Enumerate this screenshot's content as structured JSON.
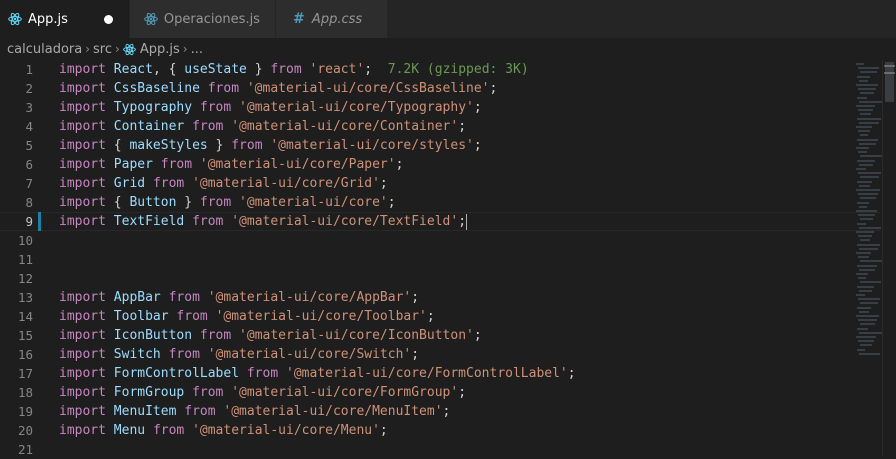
{
  "tabs": [
    {
      "label": "App.js",
      "icon": "react-icon",
      "active": true,
      "modified": true
    },
    {
      "label": "Operaciones.js",
      "icon": "react-icon",
      "active": false,
      "modified": false
    },
    {
      "label": "App.css",
      "icon": "css-hash-icon",
      "active": false,
      "modified": false
    }
  ],
  "breadcrumb": {
    "items": [
      "calculadora",
      "src",
      "App.js",
      "..."
    ]
  },
  "editor": {
    "current_line": 9,
    "lines": [
      {
        "n": "1",
        "tokens": [
          [
            "kw",
            "import"
          ],
          [
            "pn",
            " "
          ],
          [
            "id",
            "React"
          ],
          [
            "pn",
            ", { "
          ],
          [
            "id",
            "useState"
          ],
          [
            "pn",
            " } "
          ],
          [
            "kw",
            "from"
          ],
          [
            "pn",
            " "
          ],
          [
            "st",
            "'react'"
          ],
          [
            "pn",
            ";  "
          ],
          [
            "hint",
            "7.2K (gzipped: 3K)"
          ]
        ]
      },
      {
        "n": "2",
        "tokens": [
          [
            "kw",
            "import"
          ],
          [
            "pn",
            " "
          ],
          [
            "id",
            "CssBaseline"
          ],
          [
            "pn",
            " "
          ],
          [
            "kw",
            "from"
          ],
          [
            "pn",
            " "
          ],
          [
            "st",
            "'@material-ui/core/CssBaseline'"
          ],
          [
            "pn",
            ";"
          ]
        ]
      },
      {
        "n": "3",
        "tokens": [
          [
            "kw",
            "import"
          ],
          [
            "pn",
            " "
          ],
          [
            "id",
            "Typography"
          ],
          [
            "pn",
            " "
          ],
          [
            "kw",
            "from"
          ],
          [
            "pn",
            " "
          ],
          [
            "st",
            "'@material-ui/core/Typography'"
          ],
          [
            "pn",
            ";"
          ]
        ]
      },
      {
        "n": "4",
        "tokens": [
          [
            "kw",
            "import"
          ],
          [
            "pn",
            " "
          ],
          [
            "id",
            "Container"
          ],
          [
            "pn",
            " "
          ],
          [
            "kw",
            "from"
          ],
          [
            "pn",
            " "
          ],
          [
            "st",
            "'@material-ui/core/Container'"
          ],
          [
            "pn",
            ";"
          ]
        ]
      },
      {
        "n": "5",
        "tokens": [
          [
            "kw",
            "import"
          ],
          [
            "pn",
            " { "
          ],
          [
            "id",
            "makeStyles"
          ],
          [
            "pn",
            " } "
          ],
          [
            "kw",
            "from"
          ],
          [
            "pn",
            " "
          ],
          [
            "st",
            "'@material-ui/core/styles'"
          ],
          [
            "pn",
            ";"
          ]
        ]
      },
      {
        "n": "6",
        "tokens": [
          [
            "kw",
            "import"
          ],
          [
            "pn",
            " "
          ],
          [
            "id",
            "Paper"
          ],
          [
            "pn",
            " "
          ],
          [
            "kw",
            "from"
          ],
          [
            "pn",
            " "
          ],
          [
            "st",
            "'@material-ui/core/Paper'"
          ],
          [
            "pn",
            ";"
          ]
        ]
      },
      {
        "n": "7",
        "tokens": [
          [
            "kw",
            "import"
          ],
          [
            "pn",
            " "
          ],
          [
            "id",
            "Grid"
          ],
          [
            "pn",
            " "
          ],
          [
            "kw",
            "from"
          ],
          [
            "pn",
            " "
          ],
          [
            "st",
            "'@material-ui/core/Grid'"
          ],
          [
            "pn",
            ";"
          ]
        ]
      },
      {
        "n": "8",
        "tokens": [
          [
            "kw",
            "import"
          ],
          [
            "pn",
            " { "
          ],
          [
            "id",
            "Button"
          ],
          [
            "pn",
            " } "
          ],
          [
            "kw",
            "from"
          ],
          [
            "pn",
            " "
          ],
          [
            "st",
            "'@material-ui/core'"
          ],
          [
            "pn",
            ";"
          ]
        ]
      },
      {
        "n": "9",
        "tokens": [
          [
            "kw",
            "import"
          ],
          [
            "pn",
            " "
          ],
          [
            "id",
            "TextField"
          ],
          [
            "pn",
            " "
          ],
          [
            "kw",
            "from"
          ],
          [
            "pn",
            " "
          ],
          [
            "st",
            "'@material-ui/core/TextField'"
          ],
          [
            "pn",
            ";"
          ]
        ]
      },
      {
        "n": "10",
        "tokens": []
      },
      {
        "n": "11",
        "tokens": []
      },
      {
        "n": "12",
        "tokens": []
      },
      {
        "n": "13",
        "tokens": [
          [
            "kw",
            "import"
          ],
          [
            "pn",
            " "
          ],
          [
            "id",
            "AppBar"
          ],
          [
            "pn",
            " "
          ],
          [
            "kw",
            "from"
          ],
          [
            "pn",
            " "
          ],
          [
            "st",
            "'@material-ui/core/AppBar'"
          ],
          [
            "pn",
            ";"
          ]
        ]
      },
      {
        "n": "14",
        "tokens": [
          [
            "kw",
            "import"
          ],
          [
            "pn",
            " "
          ],
          [
            "id",
            "Toolbar"
          ],
          [
            "pn",
            " "
          ],
          [
            "kw",
            "from"
          ],
          [
            "pn",
            " "
          ],
          [
            "st",
            "'@material-ui/core/Toolbar'"
          ],
          [
            "pn",
            ";"
          ]
        ]
      },
      {
        "n": "15",
        "tokens": [
          [
            "kw",
            "import"
          ],
          [
            "pn",
            " "
          ],
          [
            "id",
            "IconButton"
          ],
          [
            "pn",
            " "
          ],
          [
            "kw",
            "from"
          ],
          [
            "pn",
            " "
          ],
          [
            "st",
            "'@material-ui/core/IconButton'"
          ],
          [
            "pn",
            ";"
          ]
        ]
      },
      {
        "n": "16",
        "tokens": [
          [
            "kw",
            "import"
          ],
          [
            "pn",
            " "
          ],
          [
            "id",
            "Switch"
          ],
          [
            "pn",
            " "
          ],
          [
            "kw",
            "from"
          ],
          [
            "pn",
            " "
          ],
          [
            "st",
            "'@material-ui/core/Switch'"
          ],
          [
            "pn",
            ";"
          ]
        ]
      },
      {
        "n": "17",
        "tokens": [
          [
            "kw",
            "import"
          ],
          [
            "pn",
            " "
          ],
          [
            "id",
            "FormControlLabel"
          ],
          [
            "pn",
            " "
          ],
          [
            "kw",
            "from"
          ],
          [
            "pn",
            " "
          ],
          [
            "st",
            "'@material-ui/core/FormControlLabel'"
          ],
          [
            "pn",
            ";"
          ]
        ]
      },
      {
        "n": "18",
        "tokens": [
          [
            "kw",
            "import"
          ],
          [
            "pn",
            " "
          ],
          [
            "id",
            "FormGroup"
          ],
          [
            "pn",
            " "
          ],
          [
            "kw",
            "from"
          ],
          [
            "pn",
            " "
          ],
          [
            "st",
            "'@material-ui/core/FormGroup'"
          ],
          [
            "pn",
            ";"
          ]
        ]
      },
      {
        "n": "19",
        "tokens": [
          [
            "kw",
            "import"
          ],
          [
            "pn",
            " "
          ],
          [
            "id",
            "MenuItem"
          ],
          [
            "pn",
            " "
          ],
          [
            "kw",
            "from"
          ],
          [
            "pn",
            " "
          ],
          [
            "st",
            "'@material-ui/core/MenuItem'"
          ],
          [
            "pn",
            ";"
          ]
        ]
      },
      {
        "n": "20",
        "tokens": [
          [
            "kw",
            "import"
          ],
          [
            "pn",
            " "
          ],
          [
            "id",
            "Menu"
          ],
          [
            "pn",
            " "
          ],
          [
            "kw",
            "from"
          ],
          [
            "pn",
            " "
          ],
          [
            "st",
            "'@material-ui/core/Menu'"
          ],
          [
            "pn",
            ";"
          ]
        ]
      },
      {
        "n": "21",
        "tokens": []
      }
    ]
  },
  "colors": {
    "keyword": "#c586c0",
    "identifier": "#9cdcfe",
    "string": "#ce9178",
    "hint": "#6a9955",
    "background": "#1e1e1e"
  }
}
